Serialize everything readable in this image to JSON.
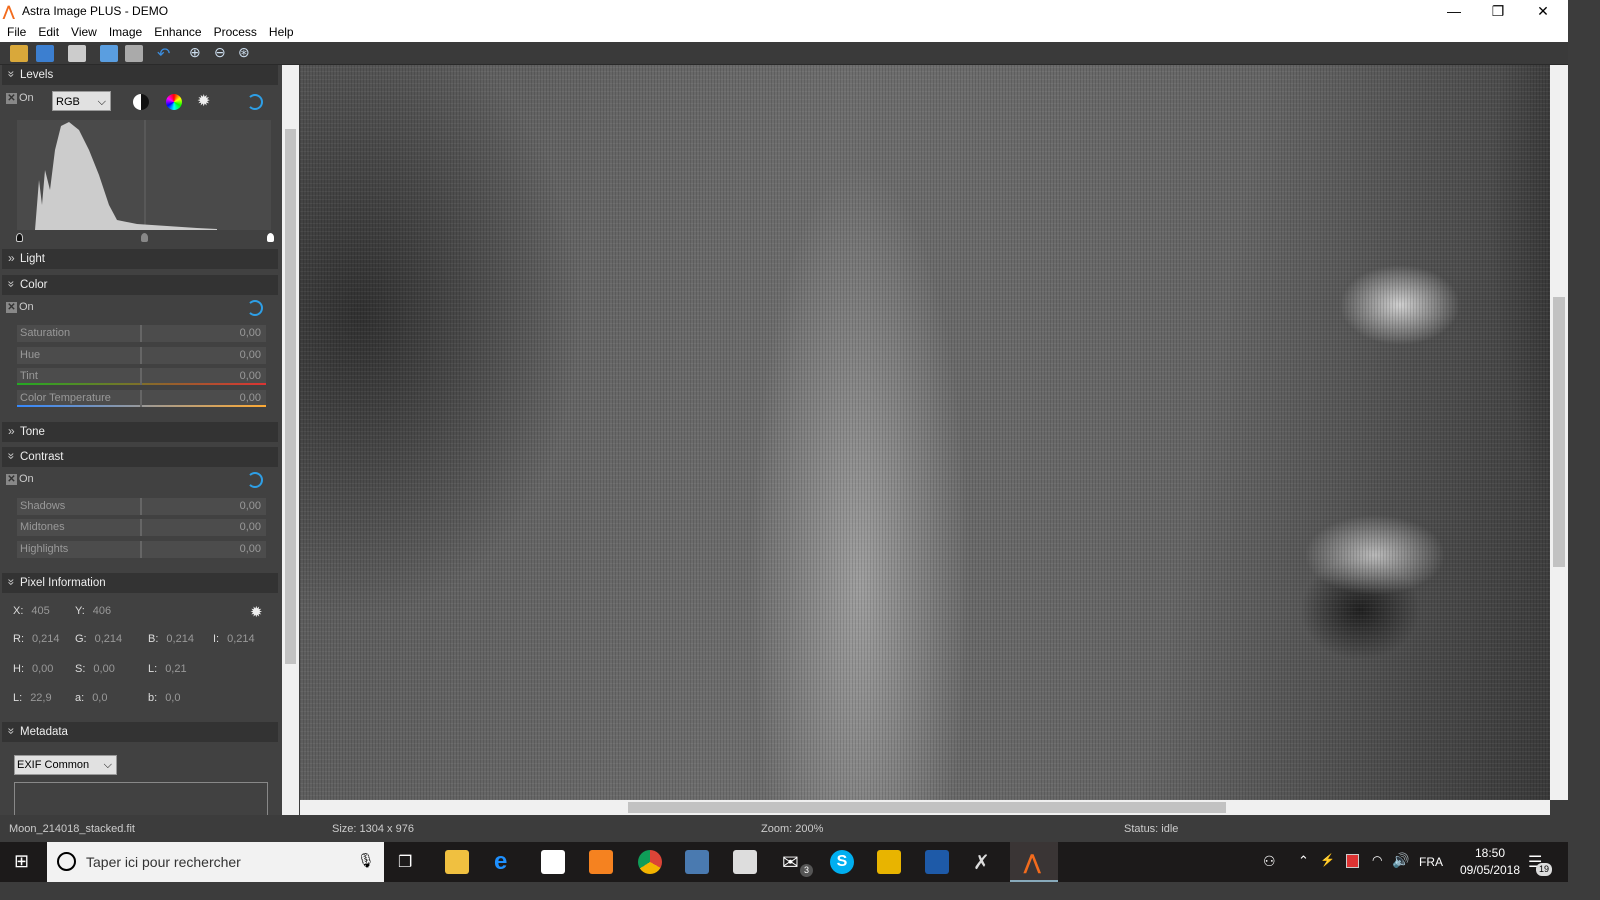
{
  "window": {
    "title": "Astra Image PLUS - DEMO"
  },
  "menu": [
    "File",
    "Edit",
    "View",
    "Image",
    "Enhance",
    "Process",
    "Help"
  ],
  "levels": {
    "title": "Levels",
    "on": "On",
    "channel": "RGB"
  },
  "light": {
    "title": "Light"
  },
  "color": {
    "title": "Color",
    "on": "On",
    "sliders": [
      {
        "label": "Saturation",
        "value": "0,00"
      },
      {
        "label": "Hue",
        "value": "0,00"
      },
      {
        "label": "Tint",
        "value": "0,00"
      },
      {
        "label": "Color Temperature",
        "value": "0,00"
      }
    ]
  },
  "tone": {
    "title": "Tone"
  },
  "contrast": {
    "title": "Contrast",
    "on": "On",
    "sliders": [
      {
        "label": "Shadows",
        "value": "0,00"
      },
      {
        "label": "Midtones",
        "value": "0,00"
      },
      {
        "label": "Highlights",
        "value": "0,00"
      }
    ]
  },
  "pixel": {
    "title": "Pixel Information",
    "x_l": "X:",
    "x": "405",
    "y_l": "Y:",
    "y": "406",
    "r_l": "R:",
    "r": "0,214",
    "g_l": "G:",
    "g": "0,214",
    "b_l": "B:",
    "b": "0,214",
    "i_l": "I:",
    "i": "0,214",
    "h_l": "H:",
    "h": "0,00",
    "s_l": "S:",
    "s": "0,00",
    "l_l": "L:",
    "l": "0,21",
    "L_l": "L:",
    "L": "22,9",
    "a_l": "a:",
    "a": "0,0",
    "bb_l": "b:",
    "bb": "0,0"
  },
  "metadata": {
    "title": "Metadata",
    "select": "EXIF Common"
  },
  "status": {
    "file": "Moon_214018_stacked.fit",
    "size": "Size: 1304 x 976",
    "zoom": "Zoom: 200%",
    "state": "Status: idle"
  },
  "taskbar": {
    "search_placeholder": "Taper ici pour rechercher",
    "lang": "FRA",
    "time": "18:50",
    "date": "09/05/2018",
    "mail_badge": "3",
    "notif_badge": "19"
  }
}
